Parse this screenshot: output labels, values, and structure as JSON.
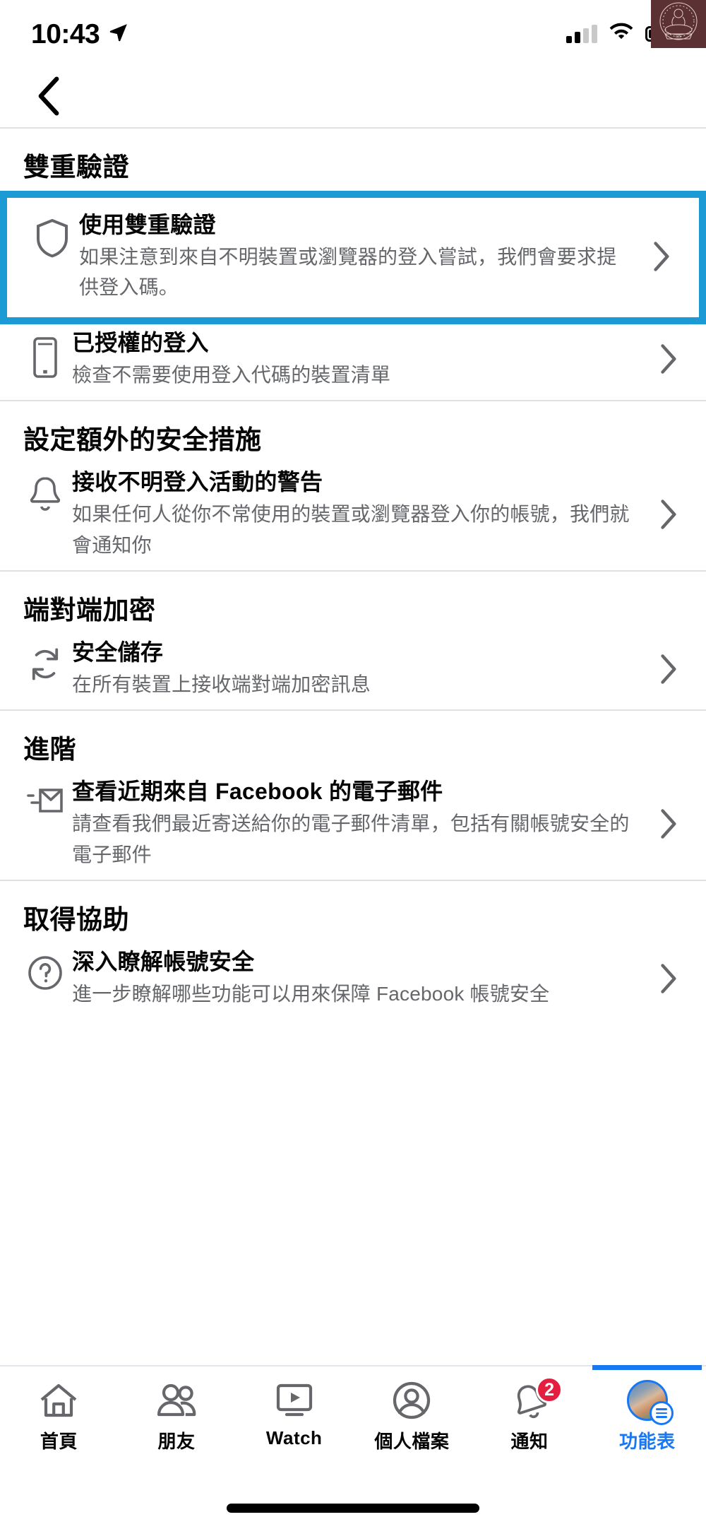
{
  "status_bar": {
    "time": "10:43",
    "location_icon": "location-arrow-icon",
    "signal_icon": "cellular-signal-icon",
    "wifi_icon": "wifi-icon",
    "battery_icon": "battery-icon",
    "watermark": "logo-watermark"
  },
  "header": {
    "back_icon": "back-chevron-icon"
  },
  "colors": {
    "highlight": "#1C9AD6",
    "accent": "#1877F2",
    "badge": "#E41E3F",
    "primary_text": "#050505",
    "secondary_text": "#65676B",
    "divider": "#DFE1E5",
    "watermark": "#5C3133"
  },
  "sections": [
    {
      "title": "雙重驗證",
      "rows": [
        {
          "icon": "shield-icon",
          "title": "使用雙重驗證",
          "subtitle": "如果注意到來自不明裝置或瀏覽器的登入嘗試，我們會要求提供登入碼。",
          "highlighted": true
        },
        {
          "icon": "mobile-phone-icon",
          "title": "已授權的登入",
          "subtitle": "檢查不需要使用登入代碼的裝置清單",
          "highlighted": false
        }
      ]
    },
    {
      "title": "設定額外的安全措施",
      "rows": [
        {
          "icon": "bell-icon",
          "title": "接收不明登入活動的警告",
          "subtitle": "如果任何人從你不常使用的裝置或瀏覽器登入你的帳號，我們就會通知你",
          "highlighted": false
        }
      ]
    },
    {
      "title": "端對端加密",
      "rows": [
        {
          "icon": "sync-refresh-icon",
          "title": "安全儲存",
          "subtitle": "在所有裝置上接收端對端加密訊息",
          "highlighted": false
        }
      ]
    },
    {
      "title": "進階",
      "rows": [
        {
          "icon": "email-send-icon",
          "title": "查看近期來自 Facebook 的電子郵件",
          "subtitle": "請查看我們最近寄送給你的電子郵件清單，包括有關帳號安全的電子郵件",
          "highlighted": false
        }
      ]
    },
    {
      "title": "取得協助",
      "rows": [
        {
          "icon": "question-circle-icon",
          "title": "深入瞭解帳號安全",
          "subtitle": "進一步瞭解哪些功能可以用來保障 Facebook 帳號安全",
          "highlighted": false
        }
      ]
    }
  ],
  "chevron_icon": "chevron-right-icon",
  "tabbar": {
    "tabs": [
      {
        "label": "首頁",
        "icon": "home-icon",
        "active": false,
        "badge": ""
      },
      {
        "label": "朋友",
        "icon": "friends-icon",
        "active": false,
        "badge": ""
      },
      {
        "label": "Watch",
        "icon": "watch-play-icon",
        "active": false,
        "badge": ""
      },
      {
        "label": "個人檔案",
        "icon": "profile-icon",
        "active": false,
        "badge": ""
      },
      {
        "label": "通知",
        "icon": "bell-icon",
        "active": false,
        "badge": "2"
      },
      {
        "label": "功能表",
        "icon": "menu-avatar-icon",
        "active": true,
        "badge": ""
      }
    ]
  }
}
